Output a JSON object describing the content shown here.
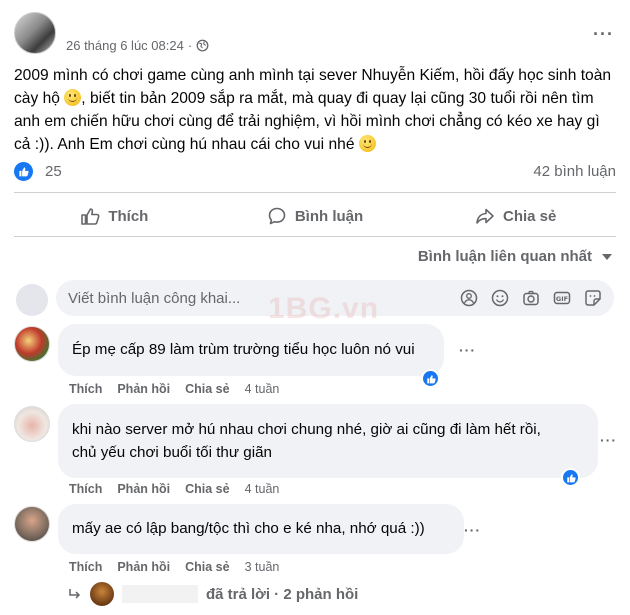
{
  "post": {
    "timestamp": "26 tháng 6 lúc 08:24",
    "separator": "·",
    "more_label": "···",
    "text_part1": "2009 mình có chơi game cùng anh mình tại sever Nhuyễn Kiếm, hồi đấy học sinh toàn cày hộ ",
    "text_part2": ", biết tin bản 2009 sắp ra mắt, mà quay đi quay lại cũng 30 tuổi rồi nên tìm anh em chiến hữu chơi cùng để trải nghiệm, vì hồi mình chơi chẳng có kéo xe hay gì cả :)). Anh Em chơi cùng hú nhau cái cho vui nhé ",
    "reaction_count": "25",
    "comment_count": "42 bình luận"
  },
  "actions": {
    "like": "Thích",
    "comment": "Bình luận",
    "share": "Chia sẻ"
  },
  "sort_label": "Bình luận liên quan nhất",
  "composer": {
    "placeholder": "Viết bình luận công khai..."
  },
  "watermark": "1BG.vn",
  "comments": [
    {
      "text": "Ép mẹ cấp 89 làm trùm trường tiểu học luôn nó vui",
      "like": "Thích",
      "reply": "Phản hồi",
      "share": "Chia sẻ",
      "time": "4 tuần"
    },
    {
      "text_line1": "khi nào server mở hú nhau chơi chung nhé, giờ ai cũng đi làm hết rồi,",
      "text_line2": "chủ yếu chơi buổi tối thư giãn",
      "like": "Thích",
      "reply": "Phản hồi",
      "share": "Chia sẻ",
      "time": "4 tuần"
    },
    {
      "text": "mấy ae có lập bang/tộc thì cho e ké nha, nhớ quá :))",
      "like": "Thích",
      "reply": "Phản hồi",
      "share": "Chia sẻ",
      "time": "3 tuần"
    }
  ],
  "replies_summary": "đã trả lời · 2 phản hồi",
  "colors": {
    "accent": "#1877f2",
    "secondary_text": "#65676b",
    "bubble_bg": "#f0f2f5"
  }
}
